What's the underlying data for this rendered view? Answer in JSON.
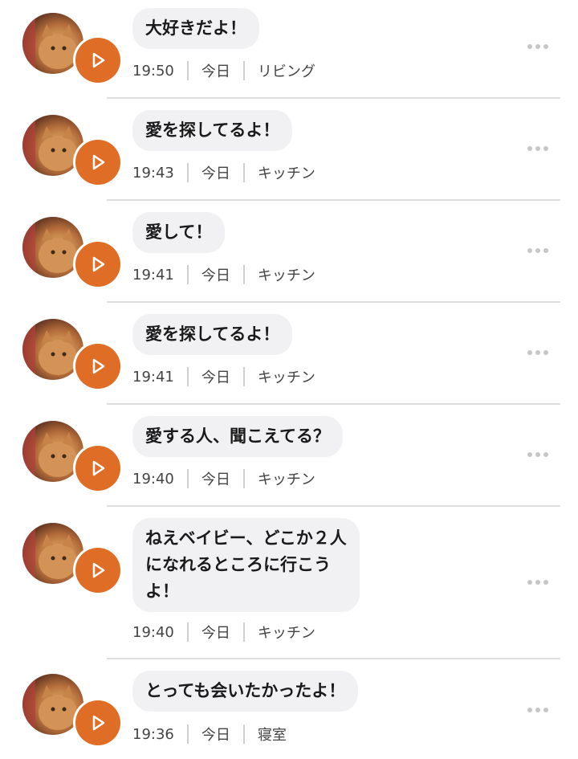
{
  "messages": [
    {
      "text": "大好きだよ！",
      "time": "19:50",
      "day": "今日",
      "room": "リビング"
    },
    {
      "text": "愛を探してるよ！",
      "time": "19:43",
      "day": "今日",
      "room": "キッチン"
    },
    {
      "text": "愛して！",
      "time": "19:41",
      "day": "今日",
      "room": "キッチン"
    },
    {
      "text": "愛を探してるよ！",
      "time": "19:41",
      "day": "今日",
      "room": "キッチン"
    },
    {
      "text": "愛する人、聞こえてる？",
      "time": "19:40",
      "day": "今日",
      "room": "キッチン"
    },
    {
      "text": "ねえベイビー、どこか２人\nになれるところに行こう\nよ！",
      "time": "19:40",
      "day": "今日",
      "room": "キッチン"
    },
    {
      "text": "とっても会いたかったよ！",
      "time": "19:36",
      "day": "今日",
      "room": "寝室"
    }
  ],
  "colors": {
    "accent": "#e06d25",
    "bubble": "#f1f1f3",
    "divider": "#dedede"
  },
  "icons": {
    "play": "play-icon",
    "more": "more-dots-icon",
    "avatar": "cat-avatar"
  }
}
